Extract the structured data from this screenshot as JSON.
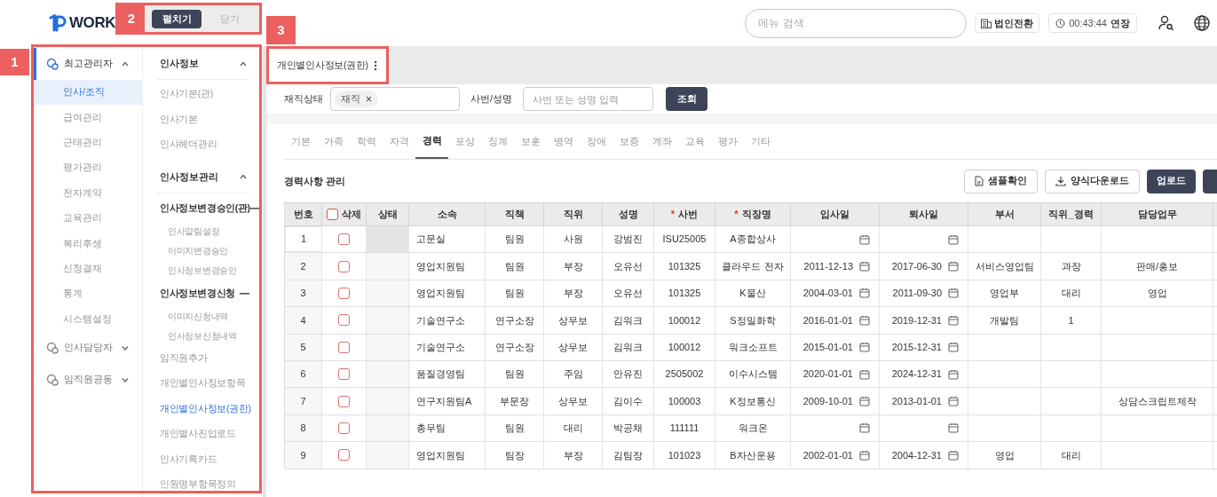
{
  "header": {
    "logo": "WORK",
    "search_placeholder": "메뉴 검색",
    "company_switch": "법인전환",
    "session_time": "00:43:44",
    "extend": "연장"
  },
  "expand_toggle": {
    "annotation": "2",
    "options": [
      {
        "label": "펼치기",
        "selected": true
      },
      {
        "label": "닫기",
        "selected": false
      }
    ]
  },
  "sidebar": {
    "annotation": "1",
    "groups": [
      {
        "label": "최고관리자",
        "expanded": true,
        "items": [
          {
            "label": "인사/조직",
            "selected": true
          },
          {
            "label": "급여관리",
            "selected": false
          },
          {
            "label": "근태관리",
            "selected": false
          },
          {
            "label": "평가관리",
            "selected": false
          },
          {
            "label": "전자계약",
            "selected": false
          },
          {
            "label": "교육관리",
            "selected": false
          },
          {
            "label": "복리후생",
            "selected": false
          },
          {
            "label": "신청결재",
            "selected": false
          },
          {
            "label": "통계",
            "selected": false
          },
          {
            "label": "시스템설정",
            "selected": false
          }
        ]
      },
      {
        "label": "인사담당자",
        "expanded": false
      },
      {
        "label": "임직원공동",
        "expanded": false
      }
    ],
    "submenu": [
      {
        "label": "인사정보",
        "expanded": true,
        "children": [
          {
            "label": "인사기본(관)",
            "selected": false
          },
          {
            "label": "인사기본",
            "selected": false
          },
          {
            "label": "인사헤더관리",
            "selected": false
          }
        ]
      },
      {
        "label": "인사정보관리",
        "expanded": true,
        "children": [
          {
            "label": "인사정보변경승인(관)",
            "expanded": true,
            "children": [
              {
                "label": "인사알림설정",
                "selected": false
              },
              {
                "label": "이미지변경승인",
                "selected": false
              },
              {
                "label": "인사정보변경승인",
                "selected": false
              }
            ]
          },
          {
            "label": "인사정보변경신청",
            "expanded": true,
            "children": [
              {
                "label": "이미지신청내역",
                "selected": false
              },
              {
                "label": "인사정보신청내역",
                "selected": false
              }
            ]
          },
          {
            "label": "임직원추가",
            "selected": false
          },
          {
            "label": "개인별인사정보항목",
            "selected": false
          },
          {
            "label": "개인별인사정보(권한)",
            "selected": true
          },
          {
            "label": "개인별사진업로드",
            "selected": false
          },
          {
            "label": "인사기록카드",
            "selected": false
          },
          {
            "label": "인원명부항목정의",
            "selected": false
          }
        ]
      }
    ]
  },
  "page_tab": {
    "label": "개인별인사정보(권한)",
    "annotation": "3"
  },
  "filters": {
    "status_label": "재직상태",
    "status_chip": "재직",
    "chip_remove": "×",
    "id_label": "사번/성명",
    "id_placeholder": "사번 또는 성명 입력",
    "search_button": "조회"
  },
  "tabs": [
    {
      "label": "기본",
      "selected": false
    },
    {
      "label": "가족",
      "selected": false
    },
    {
      "label": "학력",
      "selected": false
    },
    {
      "label": "자격",
      "selected": false
    },
    {
      "label": "경력",
      "selected": true
    },
    {
      "label": "포상",
      "selected": false
    },
    {
      "label": "징계",
      "selected": false
    },
    {
      "label": "보훈",
      "selected": false
    },
    {
      "label": "병역",
      "selected": false
    },
    {
      "label": "장애",
      "selected": false
    },
    {
      "label": "보증",
      "selected": false
    },
    {
      "label": "계좌",
      "selected": false
    },
    {
      "label": "교육",
      "selected": false
    },
    {
      "label": "평가",
      "selected": false
    },
    {
      "label": "기타",
      "selected": false
    }
  ],
  "section": {
    "title": "경력사항 관리",
    "buttons": [
      {
        "label": "샘플확인",
        "kind": "sample"
      },
      {
        "label": "양식다운로드",
        "kind": "download"
      },
      {
        "label": "업로드",
        "kind": "primary"
      }
    ]
  },
  "table": {
    "required_mark": "*",
    "columns": [
      {
        "label": "번호",
        "kind": "number",
        "required": false
      },
      {
        "label": "삭제",
        "kind": "check",
        "required": false,
        "checked": false
      },
      {
        "label": "상태",
        "kind": "status",
        "required": false
      },
      {
        "label": "소속",
        "kind": "text",
        "required": false
      },
      {
        "label": "직책",
        "kind": "text",
        "required": false
      },
      {
        "label": "직위",
        "kind": "text",
        "required": false
      },
      {
        "label": "성명",
        "kind": "text",
        "required": false
      },
      {
        "label": "사번",
        "kind": "text",
        "required": true
      },
      {
        "label": "직장명",
        "kind": "text",
        "required": true
      },
      {
        "label": "입사일",
        "kind": "date",
        "required": false
      },
      {
        "label": "퇴사일",
        "kind": "date",
        "required": false
      },
      {
        "label": "부서",
        "kind": "text",
        "required": false
      },
      {
        "label": "직위_경력",
        "kind": "text",
        "required": false
      },
      {
        "label": "담당업무",
        "kind": "text",
        "required": false
      }
    ],
    "rows": [
      {
        "checked": false,
        "selected": true,
        "cells": [
          "1",
          "",
          "",
          "고문실",
          "팀원",
          "사원",
          "강범진",
          "ISU25005",
          "A종합상사",
          "",
          "",
          "",
          "",
          ""
        ]
      },
      {
        "checked": false,
        "selected": false,
        "cells": [
          "2",
          "",
          "",
          "영업지원팀",
          "팀원",
          "부장",
          "오유선",
          "101325",
          "클라우드 전자",
          "2011-12-13",
          "2017-06-30",
          "서비스영업팀",
          "과장",
          "판매/홍보"
        ]
      },
      {
        "checked": false,
        "selected": false,
        "cells": [
          "3",
          "",
          "",
          "영업지원팀",
          "팀원",
          "부장",
          "오유선",
          "101325",
          "K물산",
          "2004-03-01",
          "2011-09-30",
          "영업부",
          "대리",
          "영업"
        ]
      },
      {
        "checked": false,
        "selected": false,
        "cells": [
          "4",
          "",
          "",
          "기술연구소",
          "연구소장",
          "상무보",
          "김워크",
          "100012",
          "S정밀화학",
          "2016-01-01",
          "2019-12-31",
          "개발팀",
          "1",
          ""
        ]
      },
      {
        "checked": false,
        "selected": false,
        "cells": [
          "5",
          "",
          "",
          "기술연구소",
          "연구소장",
          "상무보",
          "김워크",
          "100012",
          "워크소프트",
          "2015-01-01",
          "2015-12-31",
          "",
          "",
          ""
        ]
      },
      {
        "checked": false,
        "selected": false,
        "cells": [
          "6",
          "",
          "",
          "품질경영팀",
          "팀원",
          "주임",
          "안유진",
          "2505002",
          "이수시스템",
          "2020-01-01",
          "2024-12-31",
          "",
          "",
          ""
        ]
      },
      {
        "checked": false,
        "selected": false,
        "cells": [
          "7",
          "",
          "",
          "연구지원팀A",
          "부문장",
          "상무보",
          "김이수",
          "100003",
          "K정보통신",
          "2009-10-01",
          "2013-01-01",
          "",
          "",
          "상담스크립트제작"
        ]
      },
      {
        "checked": false,
        "selected": false,
        "cells": [
          "8",
          "",
          "",
          "총무팀",
          "팀원",
          "대리",
          "박공채",
          "111111",
          "워크온",
          "",
          "",
          "",
          "",
          ""
        ]
      },
      {
        "checked": false,
        "selected": false,
        "cells": [
          "9",
          "",
          "",
          "영업지원팀",
          "팀장",
          "부장",
          "김팀장",
          "101023",
          "B자산운용",
          "2002-01-01",
          "2004-12-31",
          "영업",
          "대리",
          ""
        ]
      }
    ]
  }
}
